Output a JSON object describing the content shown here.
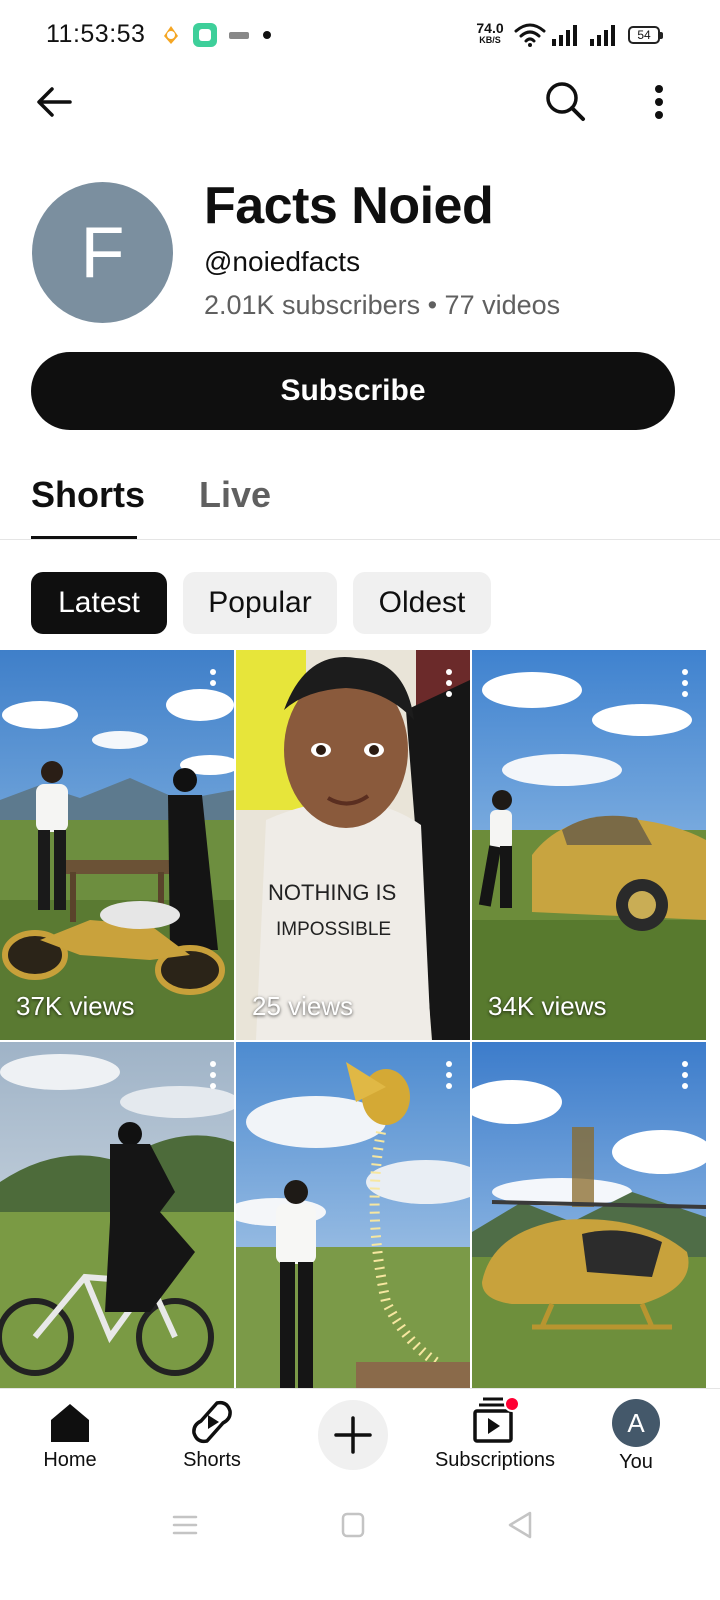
{
  "status_bar": {
    "time": "11:53:53",
    "net_speed_value": "74.0",
    "net_speed_unit": "KB/S",
    "battery": "54"
  },
  "channel": {
    "avatar_letter": "F",
    "name": "Facts Noied",
    "handle": "@noiedfacts",
    "meta": "2.01K subscribers • 77 videos",
    "subscribe_label": "Subscribe"
  },
  "tabs": [
    {
      "label": "Shorts",
      "active": true
    },
    {
      "label": "Live",
      "active": false
    }
  ],
  "chips": [
    {
      "label": "Latest",
      "selected": true
    },
    {
      "label": "Popular",
      "selected": false
    },
    {
      "label": "Oldest",
      "selected": false
    }
  ],
  "shorts": [
    {
      "views": "37K views",
      "scene": "gold motorbike on grass field"
    },
    {
      "views": "25 views",
      "scene": "boy wearing NOTHING IS IMPOSSIBLE shirt",
      "shirt_text_1": "NOTHING IS",
      "shirt_text_2": "IMPOSSIBLE"
    },
    {
      "views": "34K views",
      "scene": "woman beside gold car"
    },
    {
      "views": "",
      "scene": "woman riding bicycle"
    },
    {
      "views": "",
      "scene": "woman and golden chicken"
    },
    {
      "views": "",
      "scene": "gold helicopter"
    }
  ],
  "bottom_nav": {
    "home": "Home",
    "shorts": "Shorts",
    "subscriptions": "Subscriptions",
    "you": "You",
    "you_avatar_letter": "A"
  },
  "colors": {
    "avatar_bg": "#7b8f9f",
    "subscribe_bg": "#0f0f0f",
    "notification_dot": "#ff0033",
    "secondary_text": "#606060"
  },
  "icons": [
    "back-arrow-icon",
    "search-icon",
    "more-vert-icon",
    "home-icon",
    "shorts-icon",
    "create-plus-icon",
    "subscriptions-icon"
  ]
}
